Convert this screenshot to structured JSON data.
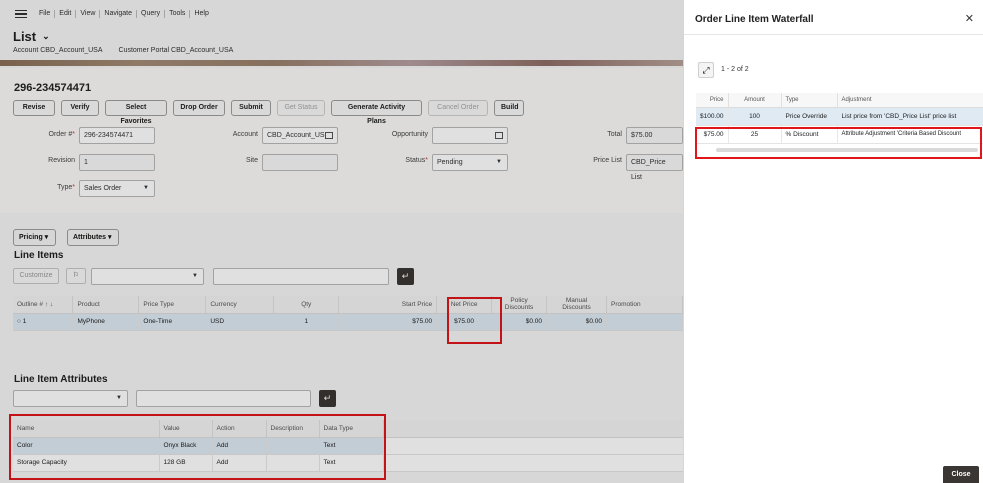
{
  "menu": [
    "File",
    "Edit",
    "View",
    "Navigate",
    "Query",
    "Tools",
    "Help"
  ],
  "page": {
    "title": "List",
    "account_label": "Account",
    "account_value": "CBD_Account_USA",
    "portal_label": "Customer Portal",
    "portal_value": "CBD_Account_USA"
  },
  "order": {
    "id": "296-234574471",
    "buttons": {
      "revise": "Revise",
      "verify": "Verify",
      "select_favorites": "Select Favorites",
      "drop_order": "Drop Order",
      "submit": "Submit",
      "get_status": "Get Status",
      "generate_activity_plans": "Generate Activity Plans",
      "cancel_order": "Cancel Order",
      "build": "Build"
    },
    "fields": {
      "order_num_label": "Order #",
      "order_num_value": "296-234574471",
      "revision_label": "Revision",
      "revision_value": "1",
      "type_label": "Type",
      "type_value": "Sales Order",
      "account_label": "Account",
      "account_value": "CBD_Account_US",
      "site_label": "Site",
      "site_value": "",
      "opportunity_label": "Opportunity",
      "opportunity_value": "",
      "status_label": "Status",
      "status_value": "Pending",
      "total_label": "Total",
      "total_value": "$75.00",
      "price_list_label": "Price List",
      "price_list_value": "CBD_Price List"
    }
  },
  "line_items": {
    "pricing_menu": "Pricing",
    "attributes_menu": "Attributes",
    "title": "Line Items",
    "customize": "Customize",
    "columns": [
      "Outline # ↑ ↓",
      "Product",
      "Price Type",
      "Currency",
      "Qty",
      "Start Price",
      "Net Price",
      "Policy Discounts",
      "Manual Discounts",
      "Promotion"
    ],
    "rows": [
      {
        "outline": "1",
        "product": "MyPhone",
        "price_type": "One-Time",
        "currency": "USD",
        "qty": "1",
        "start_price": "$75.00",
        "net_price": "$75.00",
        "policy_discounts": "$0.00",
        "manual_discounts": "$0.00",
        "promotion": ""
      }
    ]
  },
  "line_item_attributes": {
    "title": "Line Item Attributes",
    "columns": [
      "Name",
      "Value",
      "Action",
      "Description",
      "Data Type"
    ],
    "rows": [
      {
        "name": "Color",
        "value": "Onyx Black",
        "action": "Add",
        "description": "",
        "data_type": "Text"
      },
      {
        "name": "Storage Capacity",
        "value": "128 GB",
        "action": "Add",
        "description": "",
        "data_type": "Text"
      }
    ]
  },
  "drawer": {
    "title": "Order Line Item Waterfall",
    "count": "1 - 2 of 2",
    "columns": [
      "Price",
      "Amount",
      "Type",
      "Adjustment"
    ],
    "rows": [
      {
        "price": "$100.00",
        "amount": "100",
        "type": "Price Override",
        "adjustment": "List price from 'CBD_Price List' price list"
      },
      {
        "price": "$75.00",
        "amount": "25",
        "type": "% Discount",
        "adjustment": "Attribute Adjustment 'Criteria Based Discount"
      }
    ],
    "close_button": "Close"
  },
  "colors": {
    "highlight": "#e0161b",
    "link": "#2f6fa8",
    "dark_button": "#3a3633"
  }
}
